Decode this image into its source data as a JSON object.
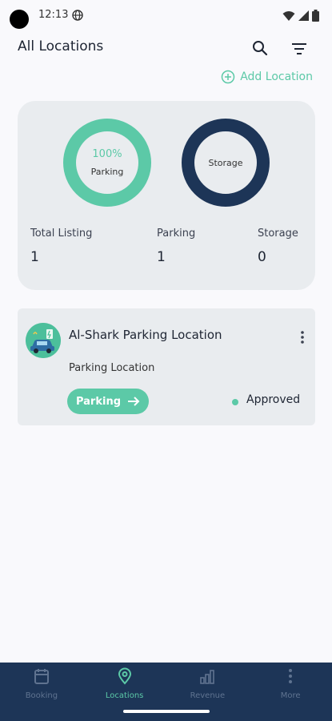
{
  "status_bar": {
    "time": "12:13"
  },
  "header": {
    "title": "All Locations"
  },
  "actions": {
    "add_location_label": "Add Location"
  },
  "summary": {
    "parking_ring_percent": "100%",
    "parking_ring_label": "Parking",
    "storage_ring_label": "Storage",
    "stats": [
      {
        "label": "Total Listing",
        "value": "1"
      },
      {
        "label": "Parking",
        "value": "1"
      },
      {
        "label": "Storage",
        "value": "0"
      }
    ]
  },
  "listings": [
    {
      "title": "Al-Shark Parking Location",
      "subtitle": "Parking Location",
      "type_button_label": "Parking",
      "status": "Approved"
    }
  ],
  "bottom_nav": {
    "items": [
      {
        "label": "Booking",
        "icon": "calendar-icon"
      },
      {
        "label": "Locations",
        "icon": "location-pin-icon",
        "active": true
      },
      {
        "label": "Revenue",
        "icon": "bar-chart-icon"
      },
      {
        "label": "More",
        "icon": "more-vertical-icon"
      }
    ]
  },
  "colors": {
    "accent": "#5cc9a7",
    "navy": "#1d3557",
    "card_bg": "#e9ecef",
    "page_bg": "#f9f9fc"
  }
}
